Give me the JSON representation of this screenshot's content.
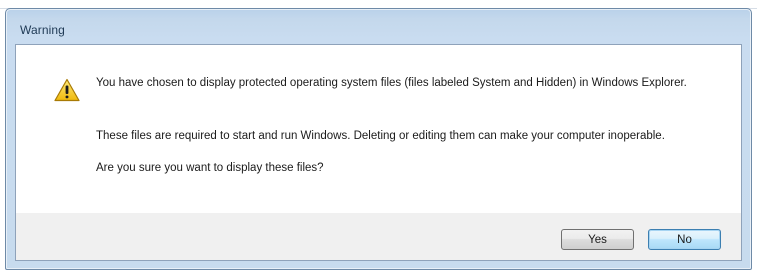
{
  "dialog": {
    "title": "Warning",
    "icon": "warning-icon",
    "message_line1": "You have chosen to display protected operating system files (files labeled System and Hidden) in Windows Explorer.",
    "message_line2": "These files are required to start and run Windows. Deleting or editing them can make your computer inoperable.",
    "message_line3": "Are you sure you want to display these files?",
    "buttons": {
      "yes_label": "Yes",
      "no_label": "No"
    }
  },
  "colors": {
    "frame": "#c7dbee",
    "warning_icon": "#f3c612",
    "default_button_border": "#3c7fb1"
  }
}
